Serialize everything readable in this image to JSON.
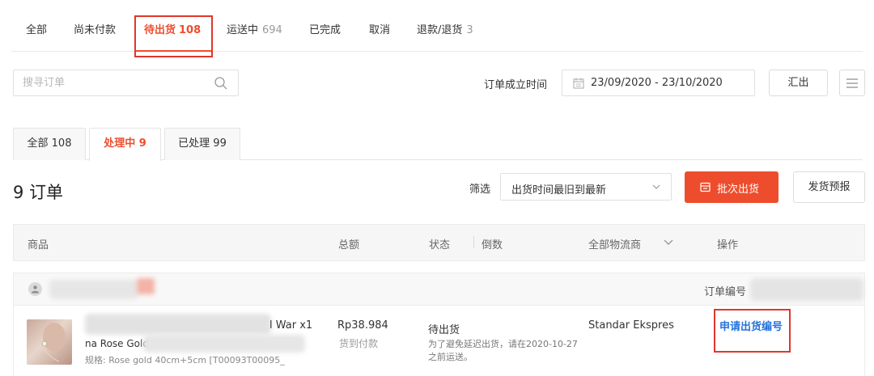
{
  "status_tabs": [
    {
      "label": "全部",
      "count": ""
    },
    {
      "label": "尚未付款",
      "count": ""
    },
    {
      "label": "待出货",
      "count": "108"
    },
    {
      "label": "运送中",
      "count": "694"
    },
    {
      "label": "已完成",
      "count": ""
    },
    {
      "label": "取消",
      "count": ""
    },
    {
      "label": "退款/退货",
      "count": "3"
    }
  ],
  "active_status_tab": "待出货",
  "search": {
    "placeholder": "搜寻订单"
  },
  "date_filter": {
    "label": "订单成立时间",
    "range": "23/09/2020 - 23/10/2020"
  },
  "export_label": "汇出",
  "sub_tabs": [
    {
      "label": "全部",
      "count": "108"
    },
    {
      "label": "处理中",
      "count": "9"
    },
    {
      "label": "已处理",
      "count": "99"
    }
  ],
  "active_sub_tab": "处理中",
  "order_count_text": "9 订单",
  "filter": {
    "label": "筛选",
    "selected": "出货时间最旧到最新"
  },
  "batch_ship_label": "批次出货",
  "ship_notice_label": "发货预报",
  "table_headers": {
    "product": "商品",
    "total": "总额",
    "status": "状态",
    "countdown": "倒数",
    "carrier": "全部物流商",
    "actions": "操作"
  },
  "order": {
    "order_no_label": "订单编号",
    "product_name_tail": "l War x1",
    "product_name_fragment": "na Rose Gold",
    "spec": "规格: Rose gold 40cm+5cm [T00093T00095_",
    "price": "Rp38.984",
    "payment": "货到付款",
    "status": "待出货",
    "status_note": "为了避免延迟出货，请在2020-10-27之前运送。",
    "carrier": "Standar Ekspres",
    "action": "申请出货编号"
  },
  "colors": {
    "accent": "#ee4d2d",
    "link": "#2673dd",
    "highlight_box": "#e0372b"
  }
}
